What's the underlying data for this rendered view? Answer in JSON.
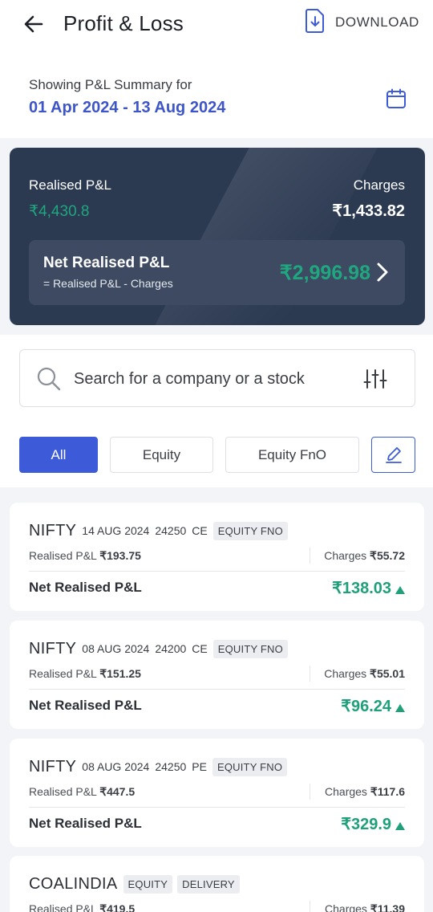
{
  "header": {
    "title": "Profit & Loss",
    "download_label": "DOWNLOAD"
  },
  "period": {
    "prefix": "Showing P&L Summary for",
    "range": "01 Apr 2024 - 13 Aug 2024"
  },
  "summary": {
    "realised_label": "Realised P&L",
    "realised_value": "₹4,430.8",
    "charges_label": "Charges",
    "charges_value": "₹1,433.82",
    "net_label": "Net Realised P&L",
    "net_formula": "= Realised P&L - Charges",
    "net_value": "₹2,996.98"
  },
  "search": {
    "placeholder": "Search for a company or a stock"
  },
  "filters": {
    "tabs": [
      {
        "label": "All",
        "active": true
      },
      {
        "label": "Equity",
        "active": false
      },
      {
        "label": "Equity FnO",
        "active": false
      }
    ]
  },
  "colors": {
    "primary": "#3d5bd8",
    "profit": "#1fa07b",
    "summary_bg": "#2b3951"
  },
  "trades": [
    {
      "symbol": "NIFTY",
      "expiry": "14 AUG 2024",
      "strike": "24250",
      "option": "CE",
      "tags": [
        "EQUITY FNO"
      ],
      "realised_label": "Realised P&L",
      "realised": "₹193.75",
      "charges_label": "Charges",
      "charges": "₹55.72",
      "net_label": "Net Realised P&L",
      "net": "₹138.03"
    },
    {
      "symbol": "NIFTY",
      "expiry": "08 AUG 2024",
      "strike": "24200",
      "option": "CE",
      "tags": [
        "EQUITY FNO"
      ],
      "realised_label": "Realised P&L",
      "realised": "₹151.25",
      "charges_label": "Charges",
      "charges": "₹55.01",
      "net_label": "Net Realised P&L",
      "net": "₹96.24"
    },
    {
      "symbol": "NIFTY",
      "expiry": "08 AUG 2024",
      "strike": "24250",
      "option": "PE",
      "tags": [
        "EQUITY FNO"
      ],
      "realised_label": "Realised P&L",
      "realised": "₹447.5",
      "charges_label": "Charges",
      "charges": "₹117.6",
      "net_label": "Net Realised P&L",
      "net": "₹329.9"
    },
    {
      "symbol": "COALINDIA",
      "tags": [
        "EQUITY",
        "DELIVERY"
      ],
      "realised_label": "Realised P&L",
      "realised": "₹419.5",
      "charges_label": "Charges",
      "charges": "₹11.39"
    }
  ]
}
